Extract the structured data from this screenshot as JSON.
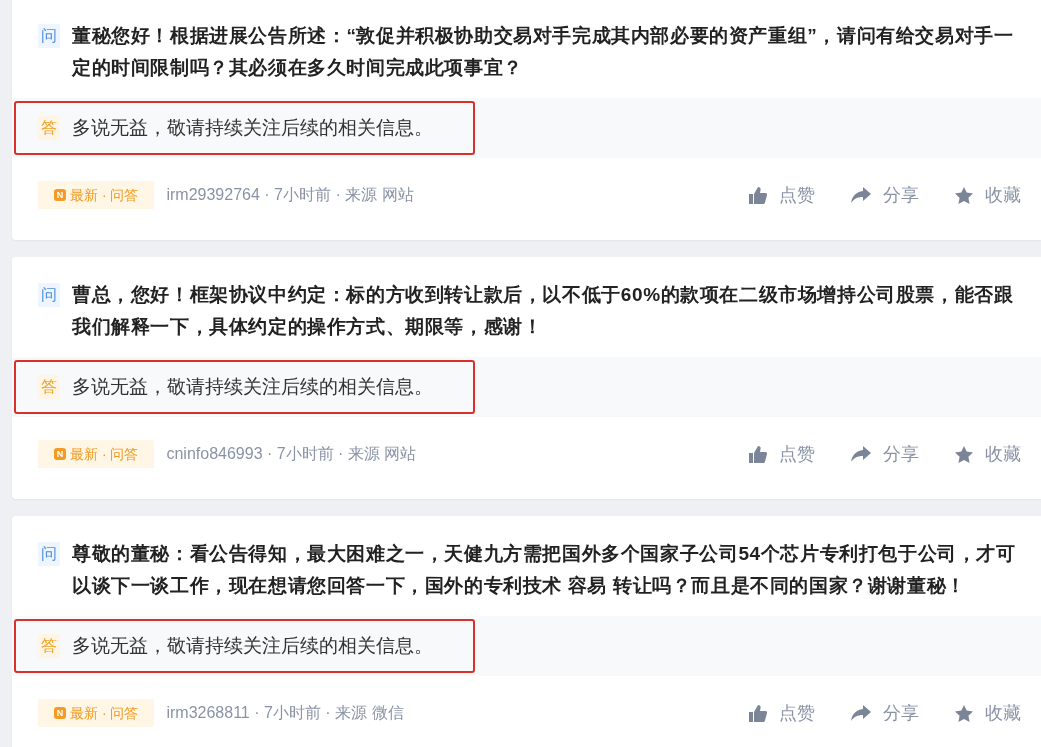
{
  "cards": [
    {
      "question_tag": "问",
      "question": "董秘您好！根据进展公告所述：“敦促并积极协助交易对手完成其内部必要的资产重组”，请问有给交易对手一定的时间限制吗？其必须在多久时间完成此项事宜？",
      "answer_tag": "答",
      "answer": "多说无益，敬请持续关注后续的相关信息。",
      "highlighted": true,
      "badge_icon": "N",
      "badge": "最新 · 问答",
      "meta": "irm29392764 · 7小时前 · 来源 网站",
      "actions": [
        {
          "kind": "like",
          "label": "点赞"
        },
        {
          "kind": "share",
          "label": "分享"
        },
        {
          "kind": "favorite",
          "label": "收藏"
        }
      ]
    },
    {
      "question_tag": "问",
      "question": "曹总，您好！框架协议中约定：标的方收到转让款后，以不低于60%的款项在二级市场增持公司股票，能否跟我们解释一下，具体约定的操作方式、期限等，感谢！",
      "answer_tag": "答",
      "answer": "多说无益，敬请持续关注后续的相关信息。",
      "highlighted": true,
      "badge_icon": "N",
      "badge": "最新 · 问答",
      "meta": "cninfo846993 · 7小时前 · 来源 网站",
      "actions": [
        {
          "kind": "like",
          "label": "点赞"
        },
        {
          "kind": "share",
          "label": "分享"
        },
        {
          "kind": "favorite",
          "label": "收藏"
        }
      ]
    },
    {
      "question_tag": "问",
      "question": "尊敬的董秘：看公告得知，最大困难之一，天健九方需把国外多个国家子公司54个芯片专利打包于公司，才可以谈下一谈工作，现在想请您回答一下，国外的专利技术 容易 转让吗？而且是不同的国家？谢谢董秘！",
      "answer_tag": "答",
      "answer": "多说无益，敬请持续关注后续的相关信息。",
      "highlighted": true,
      "badge_icon": "N",
      "badge": "最新 · 问答",
      "meta": "irm3268811 · 7小时前 · 来源 微信",
      "actions": [
        {
          "kind": "like",
          "label": "点赞"
        },
        {
          "kind": "share",
          "label": "分享"
        },
        {
          "kind": "favorite",
          "label": "收藏"
        }
      ]
    }
  ]
}
